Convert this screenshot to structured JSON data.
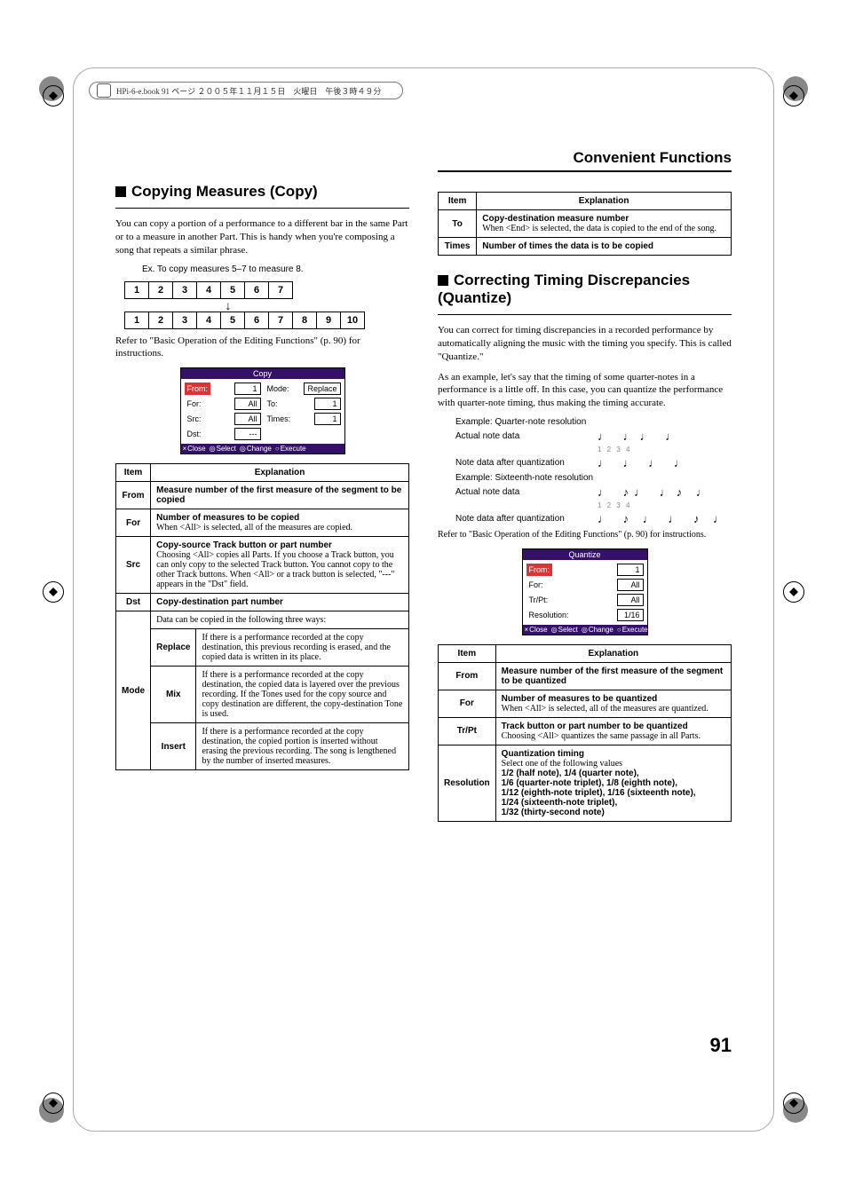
{
  "header_strip": "HPi-6-e.book 91 ページ ２００５年１１月１５日　火曜日　午後３時４９分",
  "running_head": "Convenient Functions",
  "page_number": "91",
  "copy": {
    "heading": "Copying Measures (Copy)",
    "intro": "You can copy a portion of a performance to a different bar in the same Part or to a measure in another Part. This is handy when you're composing a song that repeats a similar phrase.",
    "caption": "Ex. To copy measures 5–7 to measure 8.",
    "row1": [
      "1",
      "2",
      "3",
      "4",
      "5",
      "6",
      "7"
    ],
    "row2": [
      "1",
      "2",
      "3",
      "4",
      "5",
      "6",
      "7",
      "8",
      "9",
      "10"
    ],
    "refer": "Refer to \"Basic Operation of the Editing Functions\" (p. 90) for instructions.",
    "screen": {
      "title": "Copy",
      "from_label": "From:",
      "from_val": "1",
      "for_label": "For:",
      "for_val": "All",
      "src_label": "Src:",
      "src_val": "All",
      "dst_label": "Dst:",
      "dst_val": "---",
      "mode_label": "Mode:",
      "mode_val": "Replace",
      "to_label": "To:",
      "to_val": "1",
      "times_label": "Times:",
      "times_val": "1",
      "foot_close": "Close",
      "foot_select": "Select",
      "foot_change": "Change",
      "foot_execute": "Execute"
    },
    "table_head_item": "Item",
    "table_head_exp": "Explanation",
    "rows": {
      "from_k": "From",
      "from_v": "Measure number of the first measure of the segment to be copied",
      "for_k": "For",
      "for_v1": "Number of measures to be copied",
      "for_v2": "When <All> is selected, all of the measures are copied.",
      "src_k": "Src",
      "src_v1": "Copy-source Track button or part number",
      "src_v2": "Choosing <All> copies all Parts. If you choose a Track button, you can only copy to the selected Track button. You cannot copy to the other Track buttons. When <All> or a track button is selected, \"---\" appears in the \"Dst\" field.",
      "dst_k": "Dst",
      "dst_v": "Copy-destination part number",
      "mode_k": "Mode",
      "mode_intro": "Data can be copied in the following three ways:",
      "replace_k": "Replace",
      "replace_v": "If there is a performance recorded at the copy destination, this previous recording is erased, and the copied data is written in its place.",
      "mix_k": "Mix",
      "mix_v": "If there is a performance recorded at the copy destination, the copied data is layered over the previous recording. If the Tones used for the copy source and copy destination are different, the copy-destination Tone is used.",
      "insert_k": "Insert",
      "insert_v": "If there is a performance recorded at the copy destination, the copied portion is inserted without erasing the previous recording. The song is lengthened by the number of inserted measures."
    }
  },
  "copy2": {
    "to_k": "To",
    "to_v1": "Copy-destination measure number",
    "to_v2": "When <End> is selected, the data is copied to the end of the song.",
    "times_k": "Times",
    "times_v": "Number of times the data is to be copied"
  },
  "quant": {
    "heading": "Correcting Timing Discrepancies (Quantize)",
    "p1": "You can correct for timing discrepancies in a recorded performance by automatically aligning the music with the timing you specify. This is called \"Quantize.\"",
    "p2": "As an example, let's say that the timing of some quarter-notes in a performance is a little off. In this case, you can quantize the performance with quarter-note timing, thus making the timing accurate.",
    "ex1": "Example: Quarter-note resolution",
    "ex2": "Example: Sixteenth-note resolution",
    "lbl_actual": "Actual note data",
    "lbl_after": "Note data after quantization",
    "nums": "1 2 3 4",
    "refer": "Refer to \"Basic Operation of the Editing Functions\" (p. 90) for instructions.",
    "screen": {
      "title": "Quantize",
      "from_label": "From:",
      "from_val": "1",
      "for_label": "For:",
      "for_val": "All",
      "trpt_label": "Tr/Pt:",
      "trpt_val": "All",
      "res_label": "Resolution:",
      "res_val": "1/16",
      "foot_close": "Close",
      "foot_select": "Select",
      "foot_change": "Change",
      "foot_execute": "Execute"
    },
    "table": {
      "from_k": "From",
      "from_v": "Measure number of the first measure of the segment to be quantized",
      "for_k": "For",
      "for_v1": "Number of measures to be quantized",
      "for_v2": "When <All> is selected, all of the measures are quantized.",
      "trpt_k": "Tr/Pt",
      "trpt_v1": "Track button or part number to be quantized",
      "trpt_v2": "Choosing <All> quantizes the same passage in all Parts.",
      "res_k": "Resolution",
      "res_v1": "Quantization timing",
      "res_v2": "Select one of the following values",
      "res_v3": "1/2 (half note), 1/4 (quarter note),",
      "res_v4": "1/6 (quarter-note triplet), 1/8 (eighth note),",
      "res_v5": "1/12 (eighth-note triplet), 1/16 (sixteenth note),",
      "res_v6": "1/24 (sixteenth-note triplet),",
      "res_v7": "1/32 (thirty-second note)"
    }
  }
}
